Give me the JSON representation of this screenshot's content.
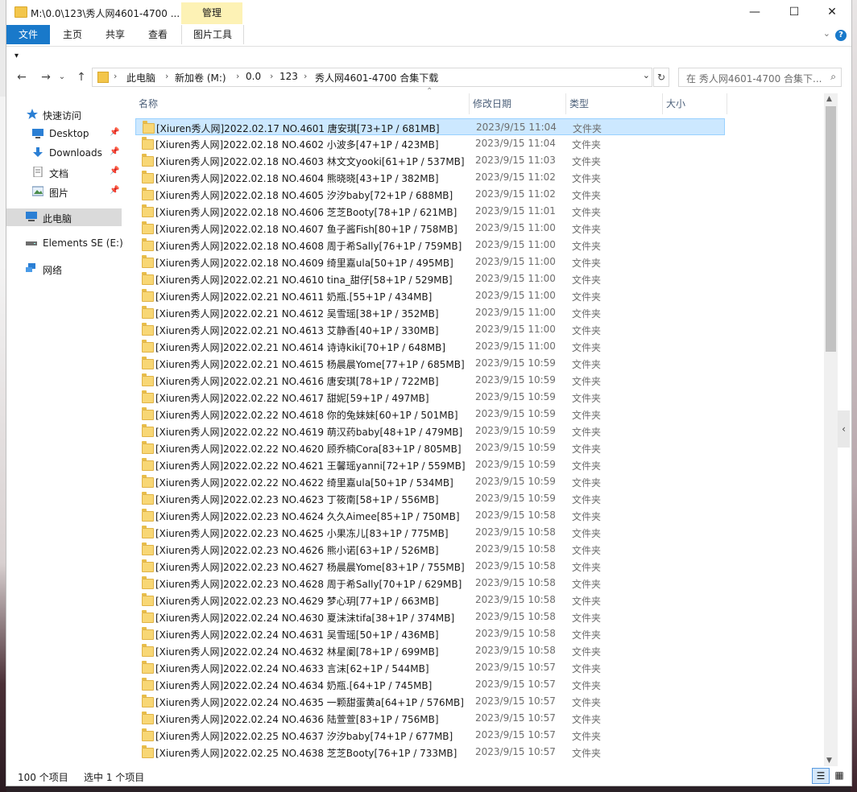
{
  "window": {
    "title": "M:\\0.0\\123\\秀人网4601-4700 ...",
    "manage_label": "管理",
    "minimize": "—",
    "maximize": "☐",
    "close": "✕"
  },
  "ribbon": {
    "tabs": [
      "文件",
      "主页",
      "共享",
      "查看",
      "图片工具"
    ],
    "collapse_icon": "chevron-down",
    "help": "?"
  },
  "quick_access_toolbar": "▾",
  "address": {
    "crumbs": [
      "此电脑",
      "新加卷 (M:)",
      "0.0",
      "123",
      "秀人网4601-4700 合集下载"
    ],
    "search_placeholder": "在 秀人网4601-4700 合集下..."
  },
  "nav": {
    "quick_access": "快速访问",
    "items": [
      {
        "label": "Desktop",
        "icon": "desktop-icon"
      },
      {
        "label": "Downloads",
        "icon": "downloads-icon"
      },
      {
        "label": "文档",
        "icon": "documents-icon"
      },
      {
        "label": "图片",
        "icon": "pictures-icon"
      }
    ],
    "this_pc": "此电脑",
    "drive": "Elements SE (E:)",
    "network": "网络"
  },
  "columns": {
    "name": "名称",
    "date": "修改日期",
    "type": "类型",
    "size": "大小"
  },
  "files": [
    {
      "name": "[Xiuren秀人网]2022.02.17 NO.4601 唐安琪[73+1P / 681MB]",
      "date": "2023/9/15 11:04",
      "type": "文件夹"
    },
    {
      "name": "[Xiuren秀人网]2022.02.18 NO.4602 小波多[47+1P / 423MB]",
      "date": "2023/9/15 11:04",
      "type": "文件夹"
    },
    {
      "name": "[Xiuren秀人网]2022.02.18 NO.4603 林文文yooki[61+1P / 537MB]",
      "date": "2023/9/15 11:03",
      "type": "文件夹"
    },
    {
      "name": "[Xiuren秀人网]2022.02.18 NO.4604 熊晓晓[43+1P / 382MB]",
      "date": "2023/9/15 11:02",
      "type": "文件夹"
    },
    {
      "name": "[Xiuren秀人网]2022.02.18 NO.4605 汐汐baby[72+1P / 688MB]",
      "date": "2023/9/15 11:02",
      "type": "文件夹"
    },
    {
      "name": "[Xiuren秀人网]2022.02.18 NO.4606 芝芝Booty[78+1P / 621MB]",
      "date": "2023/9/15 11:01",
      "type": "文件夹"
    },
    {
      "name": "[Xiuren秀人网]2022.02.18 NO.4607 鱼子酱Fish[80+1P / 758MB]",
      "date": "2023/9/15 11:00",
      "type": "文件夹"
    },
    {
      "name": "[Xiuren秀人网]2022.02.18 NO.4608 周于希Sally[76+1P / 759MB]",
      "date": "2023/9/15 11:00",
      "type": "文件夹"
    },
    {
      "name": "[Xiuren秀人网]2022.02.18 NO.4609 绮里嘉ula[50+1P / 495MB]",
      "date": "2023/9/15 11:00",
      "type": "文件夹"
    },
    {
      "name": "[Xiuren秀人网]2022.02.21 NO.4610 tina_甜仔[58+1P / 529MB]",
      "date": "2023/9/15 11:00",
      "type": "文件夹"
    },
    {
      "name": "[Xiuren秀人网]2022.02.21 NO.4611 奶瓶.[55+1P / 434MB]",
      "date": "2023/9/15 11:00",
      "type": "文件夹"
    },
    {
      "name": "[Xiuren秀人网]2022.02.21 NO.4612 吴雪瑶[38+1P / 352MB]",
      "date": "2023/9/15 11:00",
      "type": "文件夹"
    },
    {
      "name": "[Xiuren秀人网]2022.02.21 NO.4613 艾静香[40+1P / 330MB]",
      "date": "2023/9/15 11:00",
      "type": "文件夹"
    },
    {
      "name": "[Xiuren秀人网]2022.02.21 NO.4614 诗诗kiki[70+1P / 648MB]",
      "date": "2023/9/15 11:00",
      "type": "文件夹"
    },
    {
      "name": "[Xiuren秀人网]2022.02.21 NO.4615 杨晨晨Yome[77+1P / 685MB]",
      "date": "2023/9/15 10:59",
      "type": "文件夹"
    },
    {
      "name": "[Xiuren秀人网]2022.02.21 NO.4616 唐安琪[78+1P / 722MB]",
      "date": "2023/9/15 10:59",
      "type": "文件夹"
    },
    {
      "name": "[Xiuren秀人网]2022.02.22 NO.4617 甜妮[59+1P / 497MB]",
      "date": "2023/9/15 10:59",
      "type": "文件夹"
    },
    {
      "name": "[Xiuren秀人网]2022.02.22 NO.4618 你的兔妹妹[60+1P / 501MB]",
      "date": "2023/9/15 10:59",
      "type": "文件夹"
    },
    {
      "name": "[Xiuren秀人网]2022.02.22 NO.4619 萌汉药baby[48+1P / 479MB]",
      "date": "2023/9/15 10:59",
      "type": "文件夹"
    },
    {
      "name": "[Xiuren秀人网]2022.02.22 NO.4620 顾乔楠Cora[83+1P / 805MB]",
      "date": "2023/9/15 10:59",
      "type": "文件夹"
    },
    {
      "name": "[Xiuren秀人网]2022.02.22 NO.4621 王馨瑶yanni[72+1P / 559MB]",
      "date": "2023/9/15 10:59",
      "type": "文件夹"
    },
    {
      "name": "[Xiuren秀人网]2022.02.22 NO.4622 绮里嘉ula[50+1P / 534MB]",
      "date": "2023/9/15 10:59",
      "type": "文件夹"
    },
    {
      "name": "[Xiuren秀人网]2022.02.23 NO.4623 丁筱南[58+1P / 556MB]",
      "date": "2023/9/15 10:59",
      "type": "文件夹"
    },
    {
      "name": "[Xiuren秀人网]2022.02.23 NO.4624 久久Aimee[85+1P / 750MB]",
      "date": "2023/9/15 10:58",
      "type": "文件夹"
    },
    {
      "name": "[Xiuren秀人网]2022.02.23 NO.4625 小果冻儿[83+1P / 775MB]",
      "date": "2023/9/15 10:58",
      "type": "文件夹"
    },
    {
      "name": "[Xiuren秀人网]2022.02.23 NO.4626 熊小诺[63+1P / 526MB]",
      "date": "2023/9/15 10:58",
      "type": "文件夹"
    },
    {
      "name": "[Xiuren秀人网]2022.02.23 NO.4627 杨晨晨Yome[83+1P / 755MB]",
      "date": "2023/9/15 10:58",
      "type": "文件夹"
    },
    {
      "name": "[Xiuren秀人网]2022.02.23 NO.4628 周于希Sally[70+1P / 629MB]",
      "date": "2023/9/15 10:58",
      "type": "文件夹"
    },
    {
      "name": "[Xiuren秀人网]2022.02.23 NO.4629 梦心玥[77+1P / 663MB]",
      "date": "2023/9/15 10:58",
      "type": "文件夹"
    },
    {
      "name": "[Xiuren秀人网]2022.02.24 NO.4630 夏沫沫tifa[38+1P / 374MB]",
      "date": "2023/9/15 10:58",
      "type": "文件夹"
    },
    {
      "name": "[Xiuren秀人网]2022.02.24 NO.4631 吴雪瑶[50+1P / 436MB]",
      "date": "2023/9/15 10:58",
      "type": "文件夹"
    },
    {
      "name": "[Xiuren秀人网]2022.02.24 NO.4632 林星阑[78+1P / 699MB]",
      "date": "2023/9/15 10:58",
      "type": "文件夹"
    },
    {
      "name": "[Xiuren秀人网]2022.02.24 NO.4633 言沫[62+1P / 544MB]",
      "date": "2023/9/15 10:57",
      "type": "文件夹"
    },
    {
      "name": "[Xiuren秀人网]2022.02.24 NO.4634 奶瓶.[64+1P / 745MB]",
      "date": "2023/9/15 10:57",
      "type": "文件夹"
    },
    {
      "name": "[Xiuren秀人网]2022.02.24 NO.4635 一颗甜蛋黄a[64+1P / 576MB]",
      "date": "2023/9/15 10:57",
      "type": "文件夹"
    },
    {
      "name": "[Xiuren秀人网]2022.02.24 NO.4636 陆萱萱[83+1P / 756MB]",
      "date": "2023/9/15 10:57",
      "type": "文件夹"
    },
    {
      "name": "[Xiuren秀人网]2022.02.25 NO.4637 汐汐baby[74+1P / 677MB]",
      "date": "2023/9/15 10:57",
      "type": "文件夹"
    },
    {
      "name": "[Xiuren秀人网]2022.02.25 NO.4638 芝芝Booty[76+1P / 733MB]",
      "date": "2023/9/15 10:57",
      "type": "文件夹"
    }
  ],
  "status": {
    "count": "100 个项目",
    "selected": "选中 1 个项目"
  }
}
